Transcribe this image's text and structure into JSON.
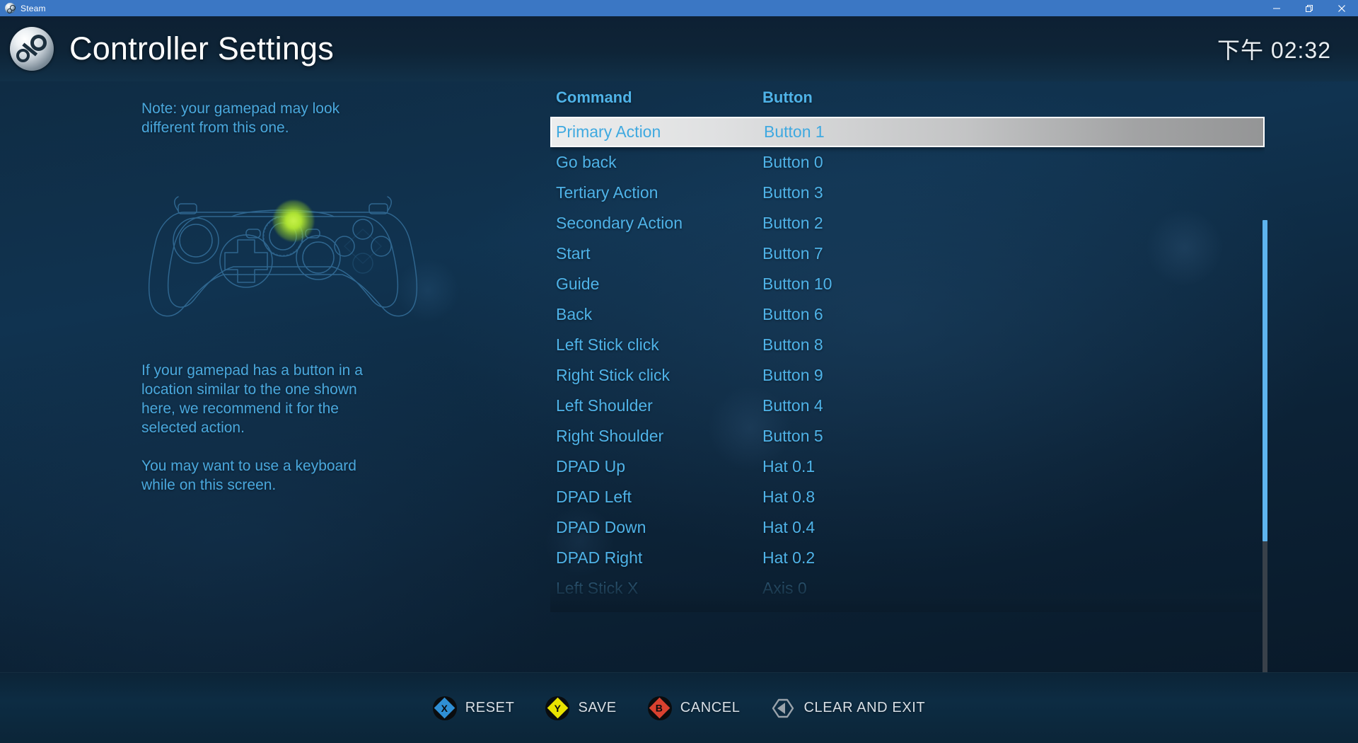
{
  "titlebar": {
    "app_name": "Steam",
    "icon": "steam-logo-icon",
    "minimize_label": "minimize-icon",
    "maximize_label": "maximize-icon",
    "close_label": "close-icon"
  },
  "header": {
    "title": "Controller Settings",
    "logo": "steam-logo-icon",
    "clock": "下午 02:32"
  },
  "left_panel": {
    "note": "Note: your gamepad may look different from this one.",
    "gamepad_illustration": "gamepad-outline-icon",
    "highlight": "green-button-glow",
    "paragraph_1": "If your gamepad has a button in a location similar to the one shown here, we recommend it for the selected action.",
    "paragraph_2": "You may want to use a keyboard while on this screen."
  },
  "table": {
    "headers": {
      "command": "Command",
      "button": "Button"
    },
    "selected_index": 0,
    "rows": [
      {
        "command": "Primary Action",
        "button": "Button 1",
        "state": "selected"
      },
      {
        "command": "Go back",
        "button": "Button 0",
        "state": "normal"
      },
      {
        "command": "Tertiary Action",
        "button": "Button 3",
        "state": "normal"
      },
      {
        "command": "Secondary Action",
        "button": "Button 2",
        "state": "normal"
      },
      {
        "command": "Start",
        "button": "Button 7",
        "state": "normal"
      },
      {
        "command": "Guide",
        "button": "Button 10",
        "state": "normal"
      },
      {
        "command": "Back",
        "button": "Button 6",
        "state": "normal"
      },
      {
        "command": "Left Stick click",
        "button": "Button 8",
        "state": "normal"
      },
      {
        "command": "Right Stick click",
        "button": "Button 9",
        "state": "normal"
      },
      {
        "command": "Left Shoulder",
        "button": "Button 4",
        "state": "normal"
      },
      {
        "command": "Right Shoulder",
        "button": "Button 5",
        "state": "normal"
      },
      {
        "command": "DPAD Up",
        "button": "Hat 0.1",
        "state": "normal"
      },
      {
        "command": "DPAD Left",
        "button": "Hat 0.8",
        "state": "normal"
      },
      {
        "command": "DPAD Down",
        "button": "Hat 0.4",
        "state": "normal"
      },
      {
        "command": "DPAD Right",
        "button": "Hat 0.2",
        "state": "normal"
      },
      {
        "command": "Left Stick X",
        "button": "Axis 0",
        "state": "faded"
      }
    ]
  },
  "scrollbar": {
    "thumb_position": "top",
    "thumb_fraction": 0.64
  },
  "footer": {
    "buttons": [
      {
        "glyph": "X",
        "label": "RESET",
        "color": "#2f8fd4",
        "icon": "gamepad-x-button-icon"
      },
      {
        "glyph": "Y",
        "label": "SAVE",
        "color": "#e9e300",
        "icon": "gamepad-y-button-icon"
      },
      {
        "glyph": "B",
        "label": "CANCEL",
        "color": "#d9412f",
        "icon": "gamepad-b-button-icon"
      },
      {
        "glyph": "◀",
        "label": "CLEAR AND EXIT",
        "color": "#9aa3ab",
        "icon": "gamepad-back-button-icon"
      }
    ]
  },
  "colors": {
    "accent_blue": "#4fb3e8",
    "header_blue": "#4fb3e8",
    "titlebar_blue": "#3b77c4",
    "highlight_green": "#aee332",
    "scroll_thumb": "#5eb4ee",
    "selected_row_light": "#eceded",
    "selected_row_dark": "#949596"
  }
}
